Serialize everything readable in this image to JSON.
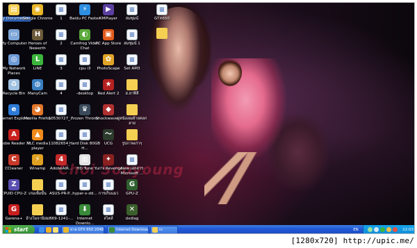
{
  "desktop": {
    "wallpaper_text": "Choi Sooyoung",
    "icons": [
      {
        "label": "My Documents",
        "icon": "documents-folder-icon",
        "color": "#f5cf52",
        "glyph": "▤",
        "selected": true
      },
      {
        "label": "Google Chrome",
        "icon": "chrome-icon",
        "color": "#e9b627",
        "glyph": "◉"
      },
      {
        "label": "1",
        "icon": "document-icon",
        "color": "#f4f6fb",
        "glyph": "≡"
      },
      {
        "label": "Baidu PC Faster",
        "icon": "baidu-pc-faster-icon",
        "color": "#2e8ee0",
        "glyph": "⚡"
      },
      {
        "label": "KMPlayer",
        "icon": "kmplayer-icon",
        "color": "#5b3fa0",
        "glyph": "▶"
      },
      {
        "label": "สมชุมน์",
        "icon": "document-icon",
        "color": "#f4f6fb",
        "glyph": "≡"
      },
      {
        "label": "GTX650",
        "icon": "document-icon",
        "color": "#f4f6fb",
        "glyph": "≡"
      },
      {
        "label": "",
        "icon": "folder-icon",
        "color": "#f5cf52",
        "glyph": ""
      },
      {
        "label": "My Computer",
        "icon": "my-computer-icon",
        "color": "#7fa6d8",
        "glyph": "▭"
      },
      {
        "label": "Heroes of Newerth",
        "icon": "heroes-of-newerth-icon",
        "color": "#6b5a3a",
        "glyph": "H"
      },
      {
        "label": "2",
        "icon": "document-icon",
        "color": "#f4f6fb",
        "glyph": "≡"
      },
      {
        "label": "Camfrog Video Chat",
        "icon": "camfrog-icon",
        "color": "#5aa83c",
        "glyph": "◐"
      },
      {
        "label": "PC App Store",
        "icon": "pc-app-store-icon",
        "color": "#e25b1c",
        "glyph": "▣"
      },
      {
        "label": "สมชุมน์ 1",
        "icon": "document-icon",
        "color": "#f4f6fb",
        "glyph": "≡"
      },
      {
        "label": "My Network Places",
        "icon": "network-places-icon",
        "color": "#6e9ad6",
        "glyph": "◎"
      },
      {
        "label": "LINE",
        "icon": "line-icon",
        "color": "#3cb53c",
        "glyph": "L"
      },
      {
        "label": "3",
        "icon": "document-icon",
        "color": "#f4f6fb",
        "glyph": "≡"
      },
      {
        "label": "cpu i3",
        "icon": "document-icon",
        "color": "#f4f6fb",
        "glyph": "≡"
      },
      {
        "label": "PhotoScape",
        "icon": "photoscape-icon",
        "color": "#e0a427",
        "glyph": "✿"
      },
      {
        "label": "Set AM3",
        "icon": "document-icon",
        "color": "#f4f6fb",
        "glyph": "≡"
      },
      {
        "label": "Recycle Bin",
        "icon": "recycle-bin-icon",
        "color": "#9fc0e0",
        "glyph": "♻"
      },
      {
        "label": "ManyCam",
        "icon": "manycam-icon",
        "color": "#3a7fc1",
        "glyph": "◍"
      },
      {
        "label": "4",
        "icon": "document-icon",
        "color": "#f4f6fb",
        "glyph": "≡"
      },
      {
        "label": "-desktop",
        "icon": "document-icon",
        "color": "#f4f6fb",
        "glyph": "≡"
      },
      {
        "label": "Red Alert 2",
        "icon": "red-alert-icon",
        "color": "#b52020",
        "glyph": "★"
      },
      {
        "label": "ฮ.ยาฟิลี",
        "icon": "folder-icon",
        "color": "#f5cf52",
        "glyph": ""
      },
      {
        "label": "Internet Explorer",
        "icon": "internet-explorer-icon",
        "color": "#2d7ad6",
        "glyph": "e"
      },
      {
        "label": "Mozilla Firefox",
        "icon": "firefox-icon",
        "color": "#e2762a",
        "glyph": "◕"
      },
      {
        "label": "10530727_...",
        "icon": "document-icon",
        "color": "#f4f6fb",
        "glyph": "≡"
      },
      {
        "label": "Frozen Throne",
        "icon": "frozen-throne-icon",
        "color": "#3a4a5a",
        "glyph": "♛"
      },
      {
        "label": "Shockwave...",
        "icon": "shockwave-icon",
        "color": "#b03030",
        "glyph": "◆"
      },
      {
        "label": "ดูหนังเผมย้ายคอกลาย",
        "icon": "folder-icon",
        "color": "#f5cf52",
        "glyph": ""
      },
      {
        "label": "Adobe Reader XI",
        "icon": "adobe-reader-icon",
        "color": "#c8201e",
        "glyph": "A"
      },
      {
        "label": "VLC media player",
        "icon": "vlc-icon",
        "color": "#f08a1c",
        "glyph": "▲"
      },
      {
        "label": "11082654_...",
        "icon": "document-icon",
        "color": "#f4f6fb",
        "glyph": "≡"
      },
      {
        "label": "Hard Disk 80GB H...",
        "icon": "document-icon",
        "color": "#f4f6fb",
        "glyph": "≡"
      },
      {
        "label": "UCG",
        "icon": "ucg-icon",
        "color": "#2c3b2c",
        "glyph": "〜"
      },
      {
        "label": "รูปภาพเก่าๆ",
        "icon": "folder-icon",
        "color": "#f5cf52",
        "glyph": ""
      },
      {
        "label": "CCleaner",
        "icon": "ccleaner-icon",
        "color": "#c83a2a",
        "glyph": "C"
      },
      {
        "label": "Winamp",
        "icon": "winamp-icon",
        "color": "#e0a020",
        "glyph": "⚡"
      },
      {
        "label": "AdobeAIR...",
        "icon": "adobe-air-icon",
        "color": "#c42a2a",
        "glyph": "4"
      },
      {
        "label": "HD Tune",
        "icon": "hd-tune-icon",
        "color": "#e2e2e2",
        "glyph": "▥"
      },
      {
        "label": "Yuri's Revenge",
        "icon": "yuris-revenge-icon",
        "color": "#8a2020",
        "glyph": "✦"
      },
      {
        "label": "New เอกสาร Microsoft ...",
        "icon": "document-icon",
        "color": "#f4f6fb",
        "glyph": "≡"
      },
      {
        "label": "CPUID CPU-Z",
        "icon": "cpu-z-icon",
        "color": "#5a4fb0",
        "glyph": "Z"
      },
      {
        "label": "เกมเพื่อนั้น",
        "icon": "folder-icon",
        "color": "#f5cf52",
        "glyph": ""
      },
      {
        "label": "ASUS-PR-P...",
        "icon": "document-icon",
        "color": "#f4f6fb",
        "glyph": "≡"
      },
      {
        "label": "hyper-x-dd...",
        "icon": "document-icon",
        "color": "#f4f6fb",
        "glyph": "≡"
      },
      {
        "label": "การเก็บแมว",
        "icon": "document-icon",
        "color": "#f4f6fb",
        "glyph": "≡"
      },
      {
        "label": "GPU-Z",
        "icon": "gpu-z-icon",
        "color": "#2f5f2f",
        "glyph": "G"
      },
      {
        "label": "Garena+",
        "icon": "garena-icon",
        "color": "#c82020",
        "glyph": "G"
      },
      {
        "label": "อ้างโมจานิยม",
        "icon": "folder-icon",
        "color": "#f5cf52",
        "glyph": ""
      },
      {
        "label": "B69-1241-...",
        "icon": "document-icon",
        "color": "#f4f6fb",
        "glyph": "≡"
      },
      {
        "label": "Internet Downlo...",
        "icon": "internet-download-manager-icon",
        "color": "#3a8a3a",
        "glyph": "⬇"
      },
      {
        "label": "สไตล์",
        "icon": "document-icon",
        "color": "#f4f6fb",
        "glyph": "≡"
      },
      {
        "label": "dxdiag",
        "icon": "dxdiag-icon",
        "color": "#3b5f2b",
        "glyph": "✕"
      }
    ]
  },
  "taskbar": {
    "start_label": "start",
    "quick_launch": [
      {
        "icon": "ie-quicklaunch-icon",
        "color": "#3b8ee8"
      },
      {
        "icon": "media-quicklaunch-icon",
        "color": "#f0b020"
      },
      {
        "icon": "desktop-quicklaunch-icon",
        "color": "#f8e070"
      }
    ],
    "tasks": [
      {
        "label": "ขาย GTX 650 2048MB...",
        "icon": "chrome-task-icon",
        "color": "#e9b627"
      },
      {
        "label": "Internet Download M...",
        "icon": "idm-task-icon",
        "color": "#3a8a3a"
      },
      {
        "label": "in",
        "icon": "folder-task-icon",
        "color": "#f5cf52"
      }
    ],
    "language": "EN",
    "tray_icons": [
      {
        "icon": "network-tray-icon",
        "color": "#9be09b"
      },
      {
        "icon": "volume-tray-icon",
        "color": "#d8e8f8"
      },
      {
        "icon": "chat-tray-icon",
        "color": "#3cb53c"
      },
      {
        "icon": "security-tray-icon",
        "color": "#f0c040"
      },
      {
        "icon": "update-tray-icon",
        "color": "#e85040"
      }
    ],
    "clock": "22:03"
  },
  "watermark": "[1280x720] http://upic.me/"
}
